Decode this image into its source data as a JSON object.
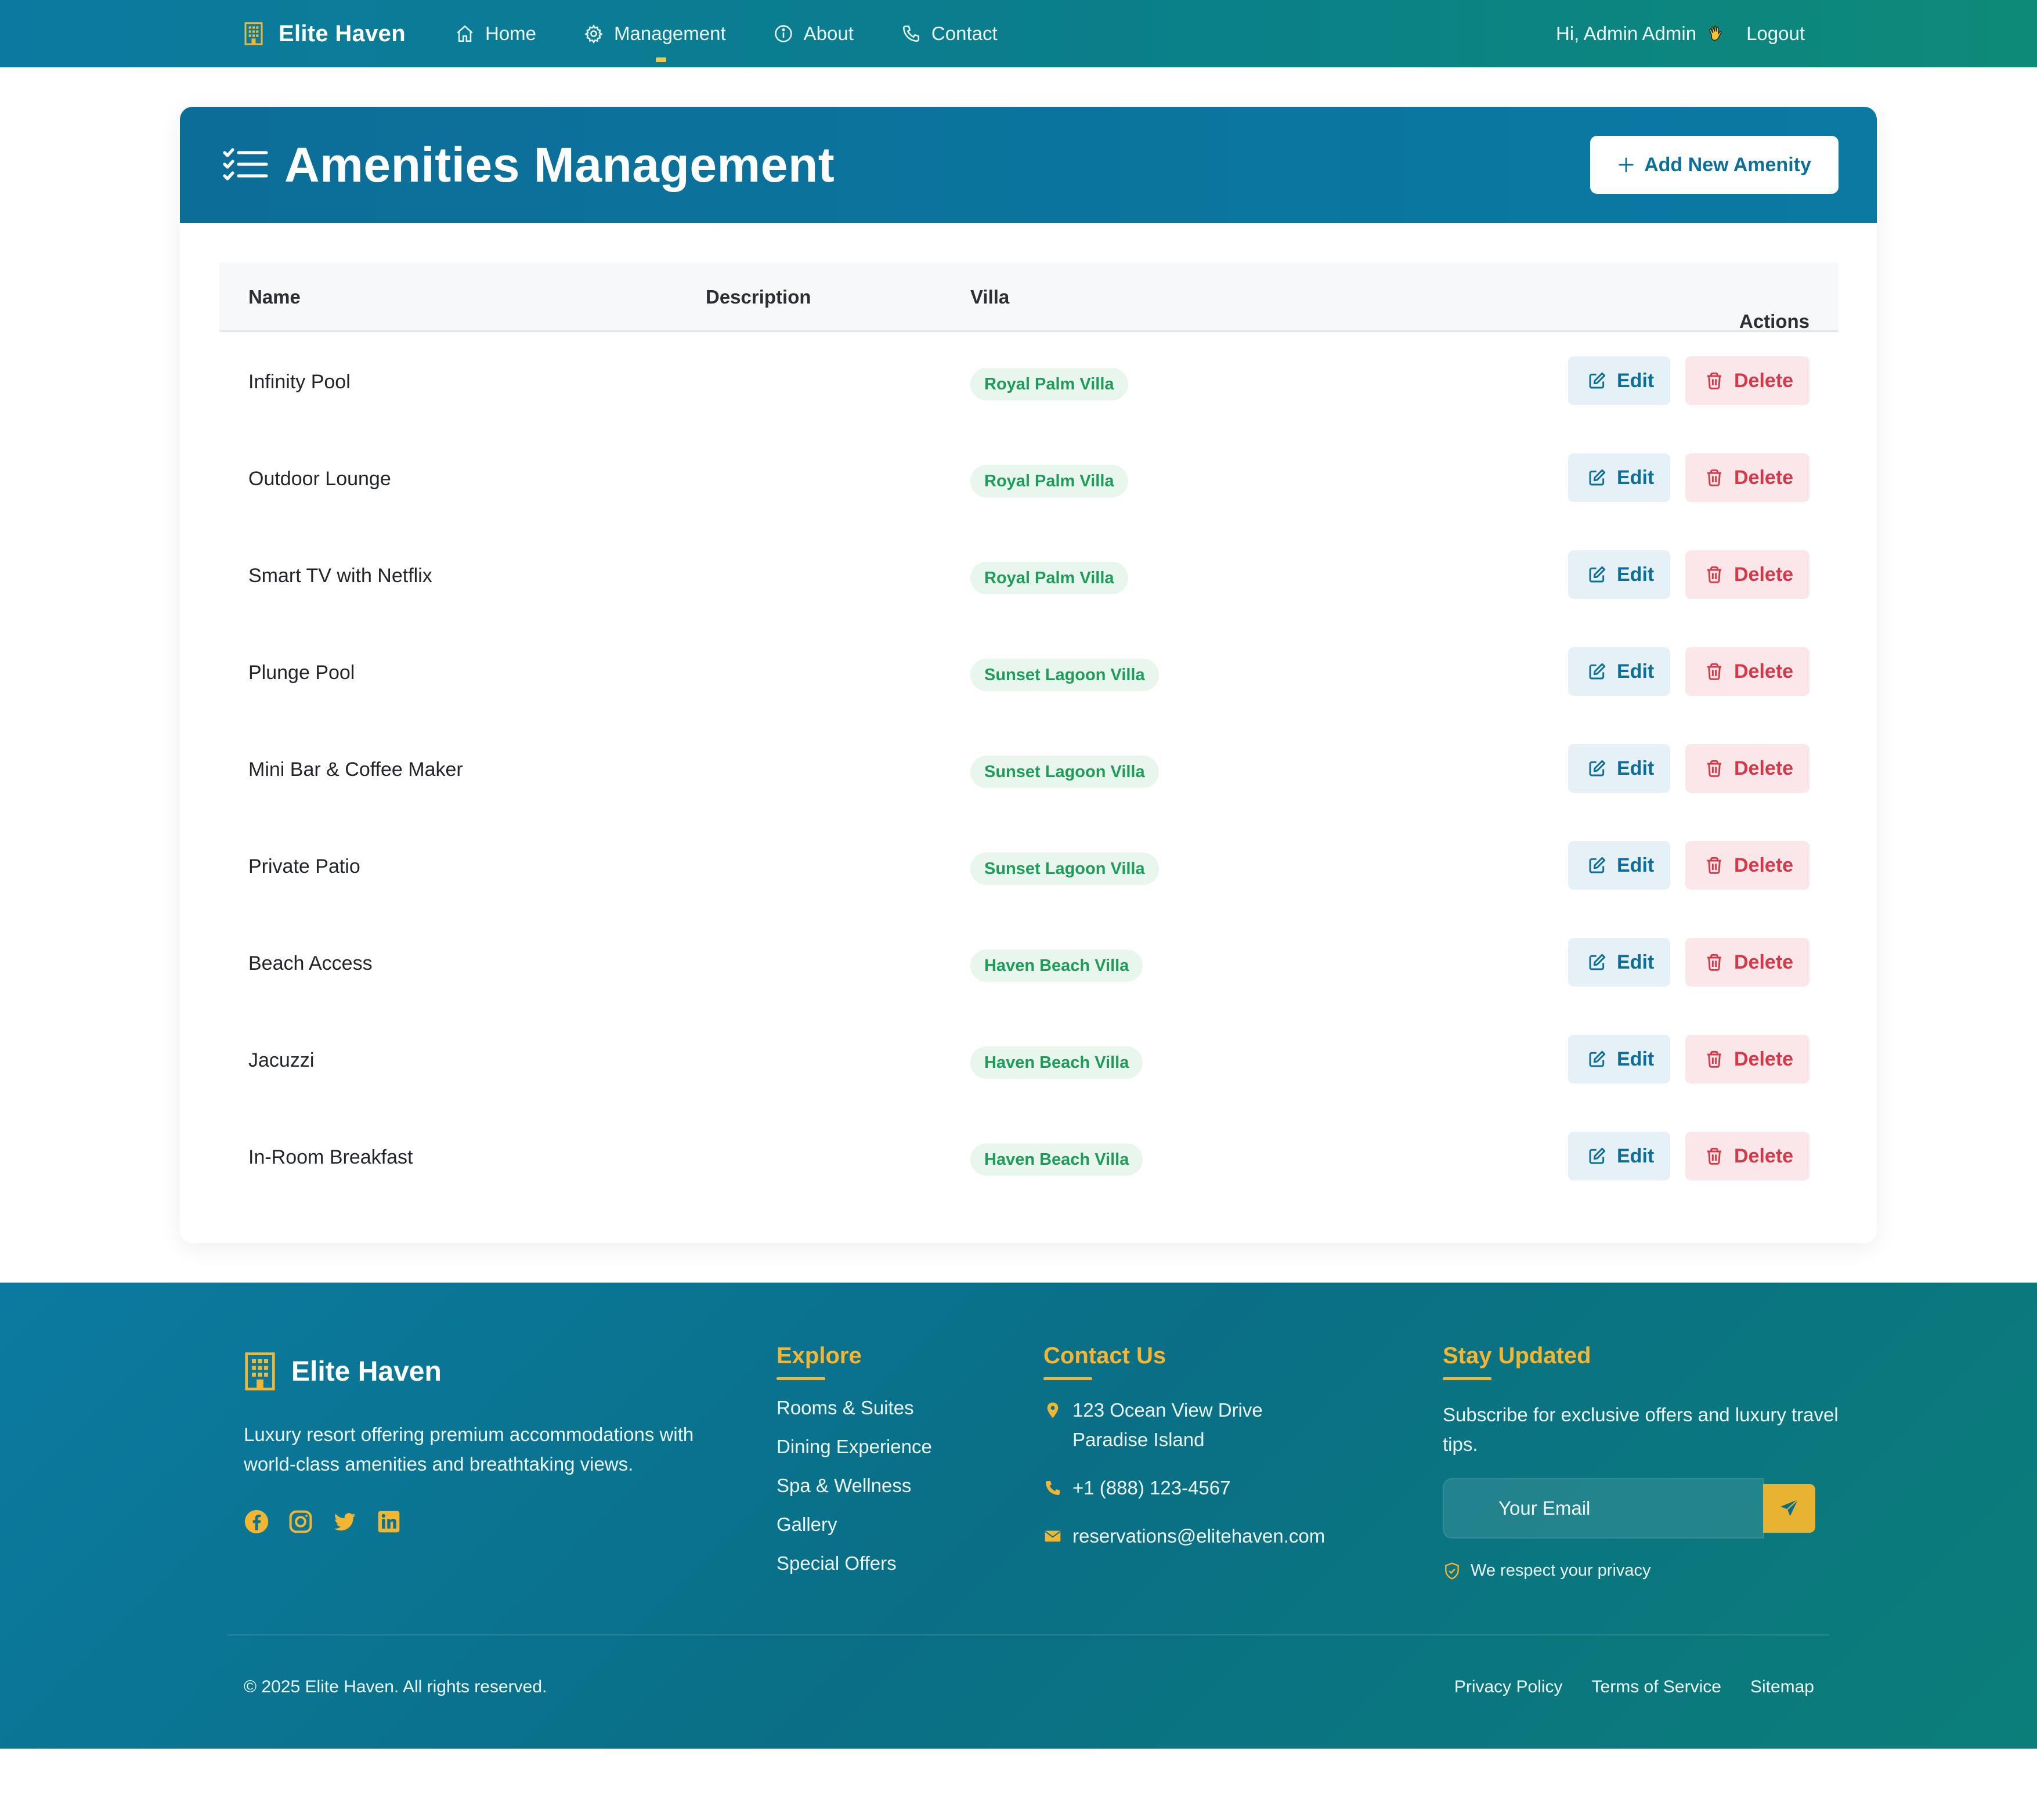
{
  "navbar": {
    "brand": "Elite Haven",
    "links": [
      {
        "label": "Home",
        "icon": "home-icon"
      },
      {
        "label": "Management",
        "icon": "gear-icon"
      },
      {
        "label": "About",
        "icon": "info-icon"
      },
      {
        "label": "Contact",
        "icon": "phone-icon"
      }
    ],
    "greeting": "Hi, Admin Admin",
    "greeting_icon": "waving-hand-icon",
    "logout": "Logout"
  },
  "page": {
    "title": "Amenities Management",
    "title_icon": "checklist-icon",
    "add_button": "Add New Amenity"
  },
  "table": {
    "headers": {
      "name": "Name",
      "description": "Description",
      "villa": "Villa",
      "actions": "Actions"
    },
    "edit_label": "Edit",
    "delete_label": "Delete",
    "rows": [
      {
        "name": "Infinity Pool",
        "description": "",
        "villa": "Royal Palm Villa"
      },
      {
        "name": "Outdoor Lounge",
        "description": "",
        "villa": "Royal Palm Villa"
      },
      {
        "name": "Smart TV with Netflix",
        "description": "",
        "villa": "Royal Palm Villa"
      },
      {
        "name": "Plunge Pool",
        "description": "",
        "villa": "Sunset Lagoon Villa"
      },
      {
        "name": "Mini Bar & Coffee Maker",
        "description": "",
        "villa": "Sunset Lagoon Villa"
      },
      {
        "name": "Private Patio",
        "description": "",
        "villa": "Sunset Lagoon Villa"
      },
      {
        "name": "Beach Access",
        "description": "",
        "villa": "Haven Beach Villa"
      },
      {
        "name": "Jacuzzi",
        "description": "",
        "villa": "Haven Beach Villa"
      },
      {
        "name": "In-Room Breakfast",
        "description": "",
        "villa": "Haven Beach Villa"
      }
    ]
  },
  "footer": {
    "brand": "Elite Haven",
    "description": "Luxury resort offering premium accommodations with world-class amenities and breathtaking views.",
    "social": [
      "facebook-icon",
      "instagram-icon",
      "twitter-icon",
      "linkedin-icon"
    ],
    "explore": {
      "heading": "Explore",
      "links": [
        "Rooms & Suites",
        "Dining Experience",
        "Spa & Wellness",
        "Gallery",
        "Special Offers"
      ]
    },
    "contact": {
      "heading": "Contact Us",
      "address_line1": "123 Ocean View Drive",
      "address_line2": "Paradise Island",
      "phone": "+1 (888) 123-4567",
      "email": "reservations@elitehaven.com"
    },
    "stay": {
      "heading": "Stay Updated",
      "text": "Subscribe for exclusive offers and luxury travel tips.",
      "email_placeholder": "Your Email",
      "privacy": "We respect your privacy"
    },
    "copyright": "© 2025 Elite Haven. All rights reserved.",
    "bottom_links": [
      "Privacy Policy",
      "Terms of Service",
      "Sitemap"
    ]
  },
  "colors": {
    "primary": "#0b7aa0",
    "accent_gold": "#f2b632",
    "badge_green": "#1f9c5a",
    "delete_red": "#d63848"
  }
}
